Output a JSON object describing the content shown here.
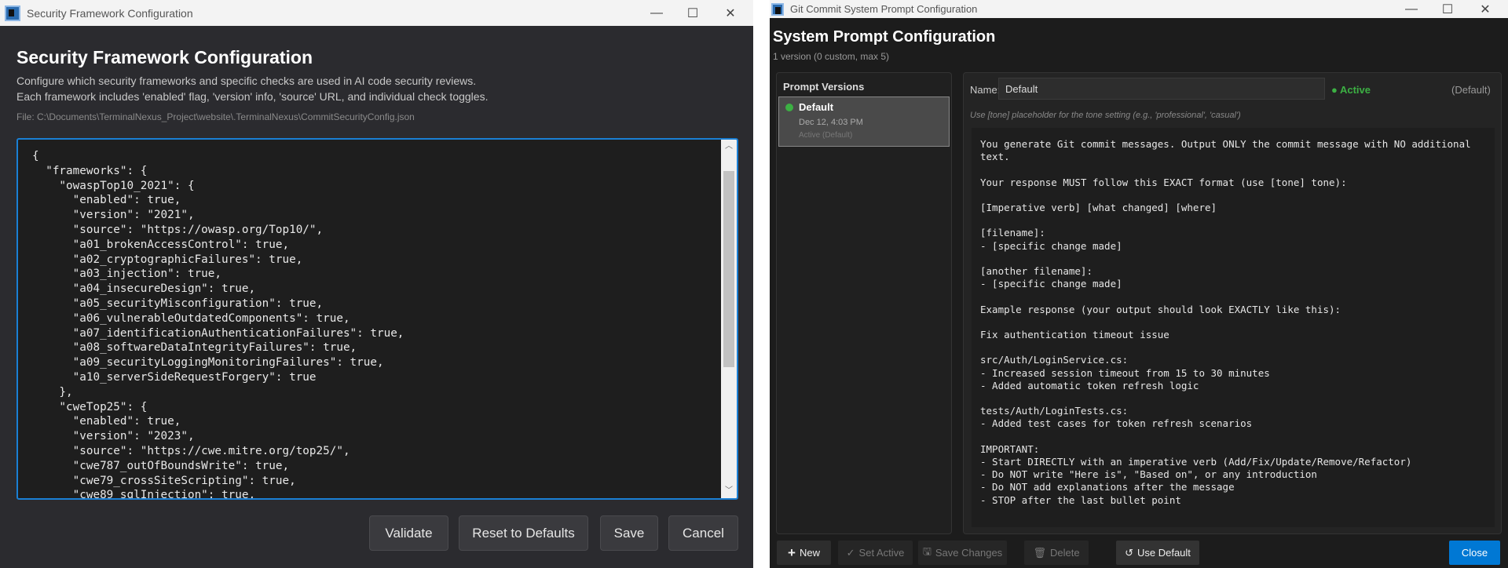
{
  "left": {
    "window_title": "Security Framework Configuration",
    "heading": "Security Framework Configuration",
    "description": [
      "Configure which security frameworks and specific checks are used in AI code security reviews.",
      "Each framework includes 'enabled' flag, 'version' info, 'source' URL, and individual check toggles."
    ],
    "file_path": "File: C:\\Documents\\TerminalNexus_Project\\website\\.TerminalNexus\\CommitSecurityConfig.json",
    "editor_lines": [
      "{",
      "  \"frameworks\": {",
      "    \"owaspTop10_2021\": {",
      "      \"enabled\": true,",
      "      \"version\": \"2021\",",
      "      \"source\": \"https://owasp.org/Top10/\",",
      "      \"a01_brokenAccessControl\": true,",
      "      \"a02_cryptographicFailures\": true,",
      "      \"a03_injection\": true,",
      "      \"a04_insecureDesign\": true,",
      "      \"a05_securityMisconfiguration\": true,",
      "      \"a06_vulnerableOutdatedComponents\": true,",
      "      \"a07_identificationAuthenticationFailures\": true,",
      "      \"a08_softwareDataIntegrityFailures\": true,",
      "      \"a09_securityLoggingMonitoringFailures\": true,",
      "      \"a10_serverSideRequestForgery\": true",
      "    },",
      "    \"cweTop25\": {",
      "      \"enabled\": true,",
      "      \"version\": \"2023\",",
      "      \"source\": \"https://cwe.mitre.org/top25/\",",
      "      \"cwe787_outOfBoundsWrite\": true,",
      "      \"cwe79_crossSiteScripting\": true,",
      "      \"cwe89_sqlInjection\": true,"
    ],
    "buttons": {
      "validate": "Validate",
      "reset": "Reset to Defaults",
      "save": "Save",
      "cancel": "Cancel"
    }
  },
  "right": {
    "window_title": "Git Commit System Prompt Configuration",
    "heading": "System Prompt Configuration",
    "subtitle": "1 version (0 custom, max 5)",
    "versions_header": "Prompt Versions",
    "versions": [
      {
        "name": "Default",
        "date": "Dec 12, 4:03 PM",
        "status": "Active (Default)"
      }
    ],
    "name_label": "Name:",
    "name_value": "Default",
    "active_label": "● Active",
    "active_suffix": "(Default)",
    "hint": "Use [tone] placeholder for the tone setting (e.g., 'professional', 'casual')",
    "prompt_text": "You generate Git commit messages. Output ONLY the commit message with NO additional\ntext.\n\nYour response MUST follow this EXACT format (use [tone] tone):\n\n[Imperative verb] [what changed] [where]\n\n[filename]:\n- [specific change made]\n\n[another filename]:\n- [specific change made]\n\nExample response (your output should look EXACTLY like this):\n\nFix authentication timeout issue\n\nsrc/Auth/LoginService.cs:\n- Increased session timeout from 15 to 30 minutes\n- Added automatic token refresh logic\n\ntests/Auth/LoginTests.cs:\n- Added test cases for token refresh scenarios\n\nIMPORTANT:\n- Start DIRECTLY with an imperative verb (Add/Fix/Update/Remove/Refactor)\n- Do NOT write \"Here is\", \"Based on\", or any introduction\n- Do NOT add explanations after the message\n- STOP after the last bullet point",
    "buttons": {
      "new": "New",
      "set_active": "Set Active",
      "save_changes": "Save Changes",
      "delete": "Delete",
      "use_default": "Use Default",
      "close": "Close"
    }
  },
  "colors": {
    "accent": "#0078d4",
    "active_green": "#3cb043"
  }
}
